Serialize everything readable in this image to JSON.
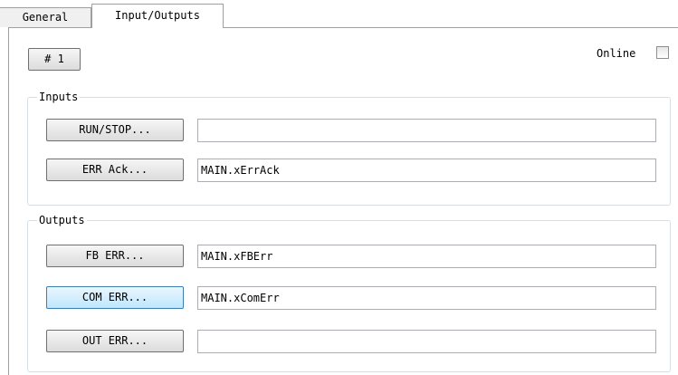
{
  "tabs": [
    {
      "label": "General"
    },
    {
      "label": "Input/Outputs"
    }
  ],
  "device_button": {
    "label": "# 1"
  },
  "online": {
    "label": "Online",
    "checked": false
  },
  "inputs": {
    "title": "Inputs",
    "rows": [
      {
        "button": "RUN/STOP...",
        "value": ""
      },
      {
        "button": "ERR Ack...",
        "value": "MAIN.xErrAck"
      }
    ]
  },
  "outputs": {
    "title": "Outputs",
    "rows": [
      {
        "button": "FB ERR...",
        "value": "MAIN.xFBErr"
      },
      {
        "button": "COM ERR...",
        "value": "MAIN.xComErr"
      },
      {
        "button": "OUT ERR...",
        "value": ""
      }
    ]
  }
}
